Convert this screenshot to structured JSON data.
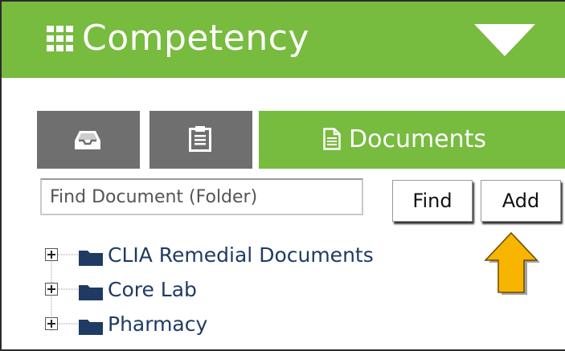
{
  "header": {
    "title": "Competency",
    "grid_icon": "grid-icon",
    "menu_icon": "triangle-down-icon",
    "background": "#77bb3f"
  },
  "tabs": [
    {
      "icon": "inbox-tray-icon",
      "label": "",
      "active": false
    },
    {
      "icon": "clipboard-icon",
      "label": "",
      "active": false
    },
    {
      "icon": "document-icon",
      "label": "Documents",
      "active": true
    }
  ],
  "search": {
    "placeholder": "Find Document (Folder)",
    "value": "",
    "find_label": "Find",
    "add_label": "Add"
  },
  "annotation": {
    "icon": "arrow-up-icon",
    "color": "#f7b500"
  },
  "tree": {
    "items": [
      {
        "label": "CLIA Remedial Documents",
        "icon": "folder-icon",
        "toggle": "plus-box-icon"
      },
      {
        "label": "Core Lab",
        "icon": "folder-icon",
        "toggle": "plus-box-icon"
      },
      {
        "label": "Pharmacy",
        "icon": "folder-icon",
        "toggle": "plus-box-icon"
      }
    ],
    "folder_color": "#1f3b64"
  }
}
